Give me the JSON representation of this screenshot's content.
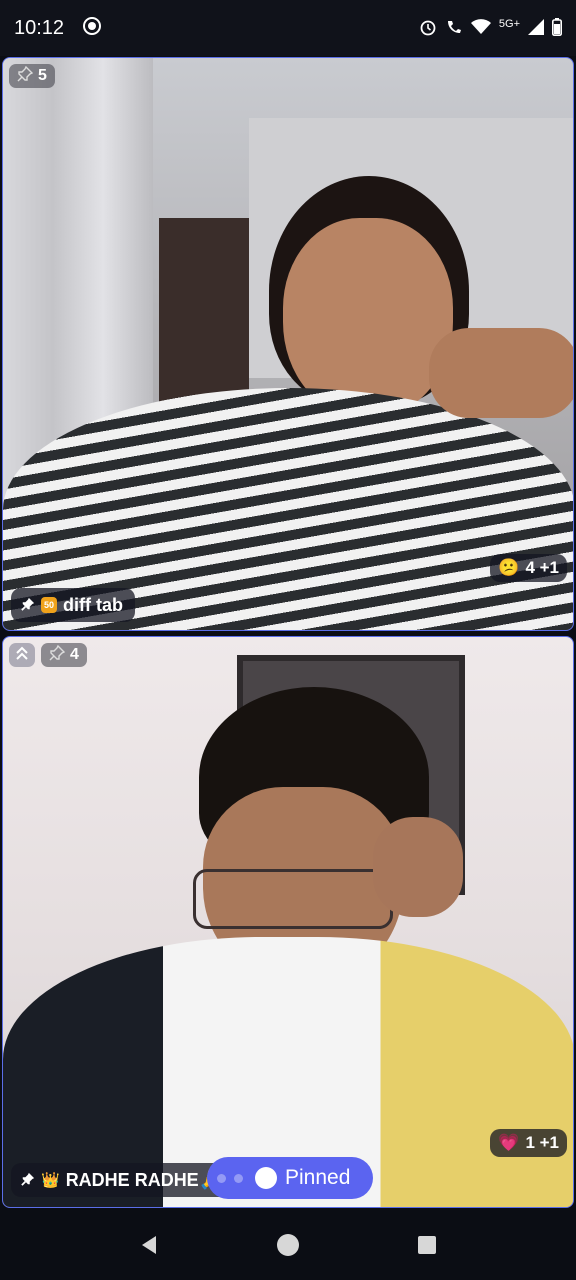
{
  "status_bar": {
    "time": "10:12",
    "network": "5G+",
    "icons": [
      "record-icon",
      "alarm-icon",
      "wifi-call-icon",
      "wifi-icon",
      "signal-icon",
      "battery-icon"
    ]
  },
  "tiles": [
    {
      "pin_count": "5",
      "name": "diff tab",
      "name_badge": "50",
      "reaction_emoji": "😕",
      "reaction_count": "4 +1"
    },
    {
      "pin_count": "4",
      "name": "RADHE RADHE🙏",
      "name_badge": "👑",
      "reaction_emoji": "💗",
      "reaction_count": "1 +1"
    }
  ],
  "pinned_control": {
    "label": "Pinned"
  },
  "colors": {
    "accent": "#5b64f0",
    "tile_border": "#5b6ee8"
  }
}
